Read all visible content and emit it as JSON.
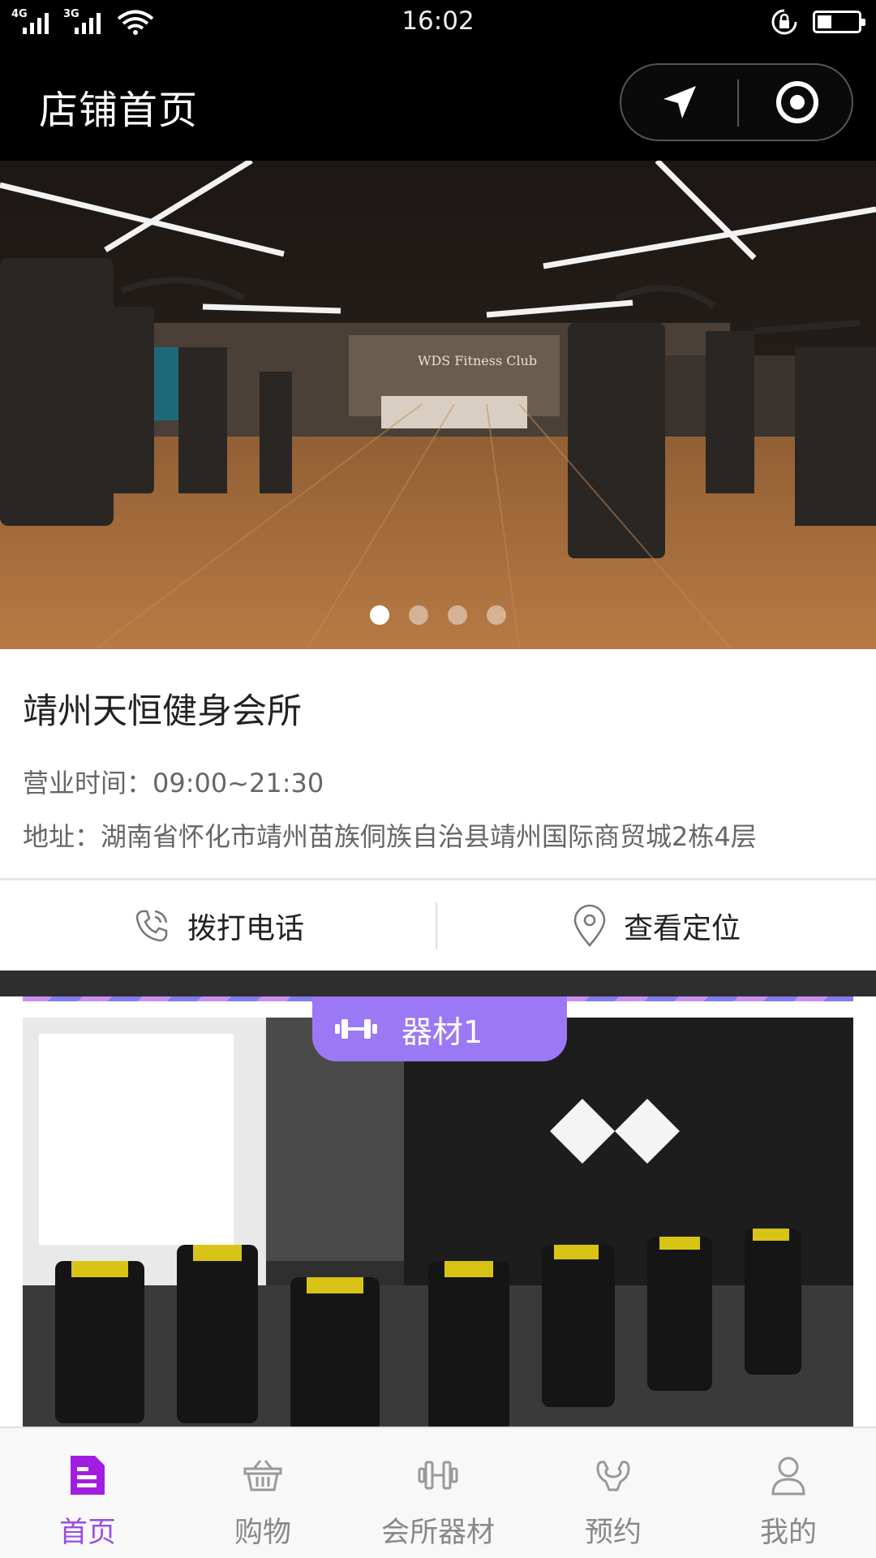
{
  "status_bar": {
    "network_1": "4G",
    "network_2": "3G",
    "time": "16:02",
    "icons": [
      "signal-icon",
      "wifi-icon",
      "rotation-lock-icon",
      "battery-icon"
    ]
  },
  "nav": {
    "title": "店铺首页",
    "capsule_icons": [
      "location-arrow-icon",
      "target-icon"
    ]
  },
  "banner": {
    "slide_count": 4,
    "active_index": 0,
    "sign_text": "WDS Fitness Club"
  },
  "store": {
    "name": "靖州天恒健身会所",
    "hours": "营业时间：09:00~21:30",
    "address": "地址：湖南省怀化市靖州苗族侗族自治县靖州国际商贸城2栋4层"
  },
  "actions": {
    "call_label": "拨打电话",
    "locate_label": "查看定位"
  },
  "equipment": {
    "badge_label": "器材1"
  },
  "tabs": [
    {
      "label": "首页",
      "icon": "home-document-icon",
      "active": true
    },
    {
      "label": "购物",
      "icon": "basket-icon",
      "active": false
    },
    {
      "label": "会所器材",
      "icon": "dumbbell-icon",
      "active": false
    },
    {
      "label": "预约",
      "icon": "muscle-icon",
      "active": false
    },
    {
      "label": "我的",
      "icon": "user-icon",
      "active": false
    }
  ],
  "colors": {
    "accent": "#9a4fe0",
    "badge": "#9b78f4",
    "status_bg": "#000000"
  }
}
